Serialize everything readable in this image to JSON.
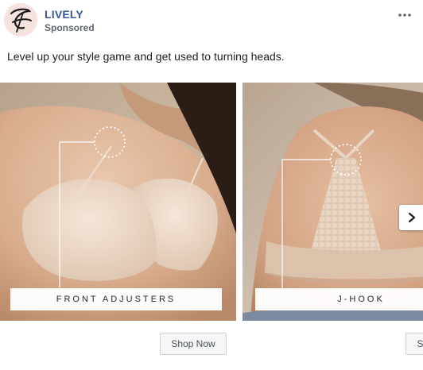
{
  "header": {
    "page_name": "LIVELY",
    "sponsored": "Sponsored",
    "more_icon": "more-dots-icon",
    "avatar_icon": "lively-logo-icon"
  },
  "post": {
    "caption": "Level up your style game and get used to turning heads."
  },
  "carousel": {
    "cards": [
      {
        "label": "FRONT ADJUSTERS",
        "cta": "Shop Now"
      },
      {
        "label": "J-HOOK",
        "cta": "Shop Now"
      }
    ],
    "next_icon": "chevron-right-icon"
  },
  "colors": {
    "page_name": "#385898",
    "secondary_text": "#606770",
    "body_text": "#1c1e21",
    "button_bg": "#f5f6f7"
  }
}
